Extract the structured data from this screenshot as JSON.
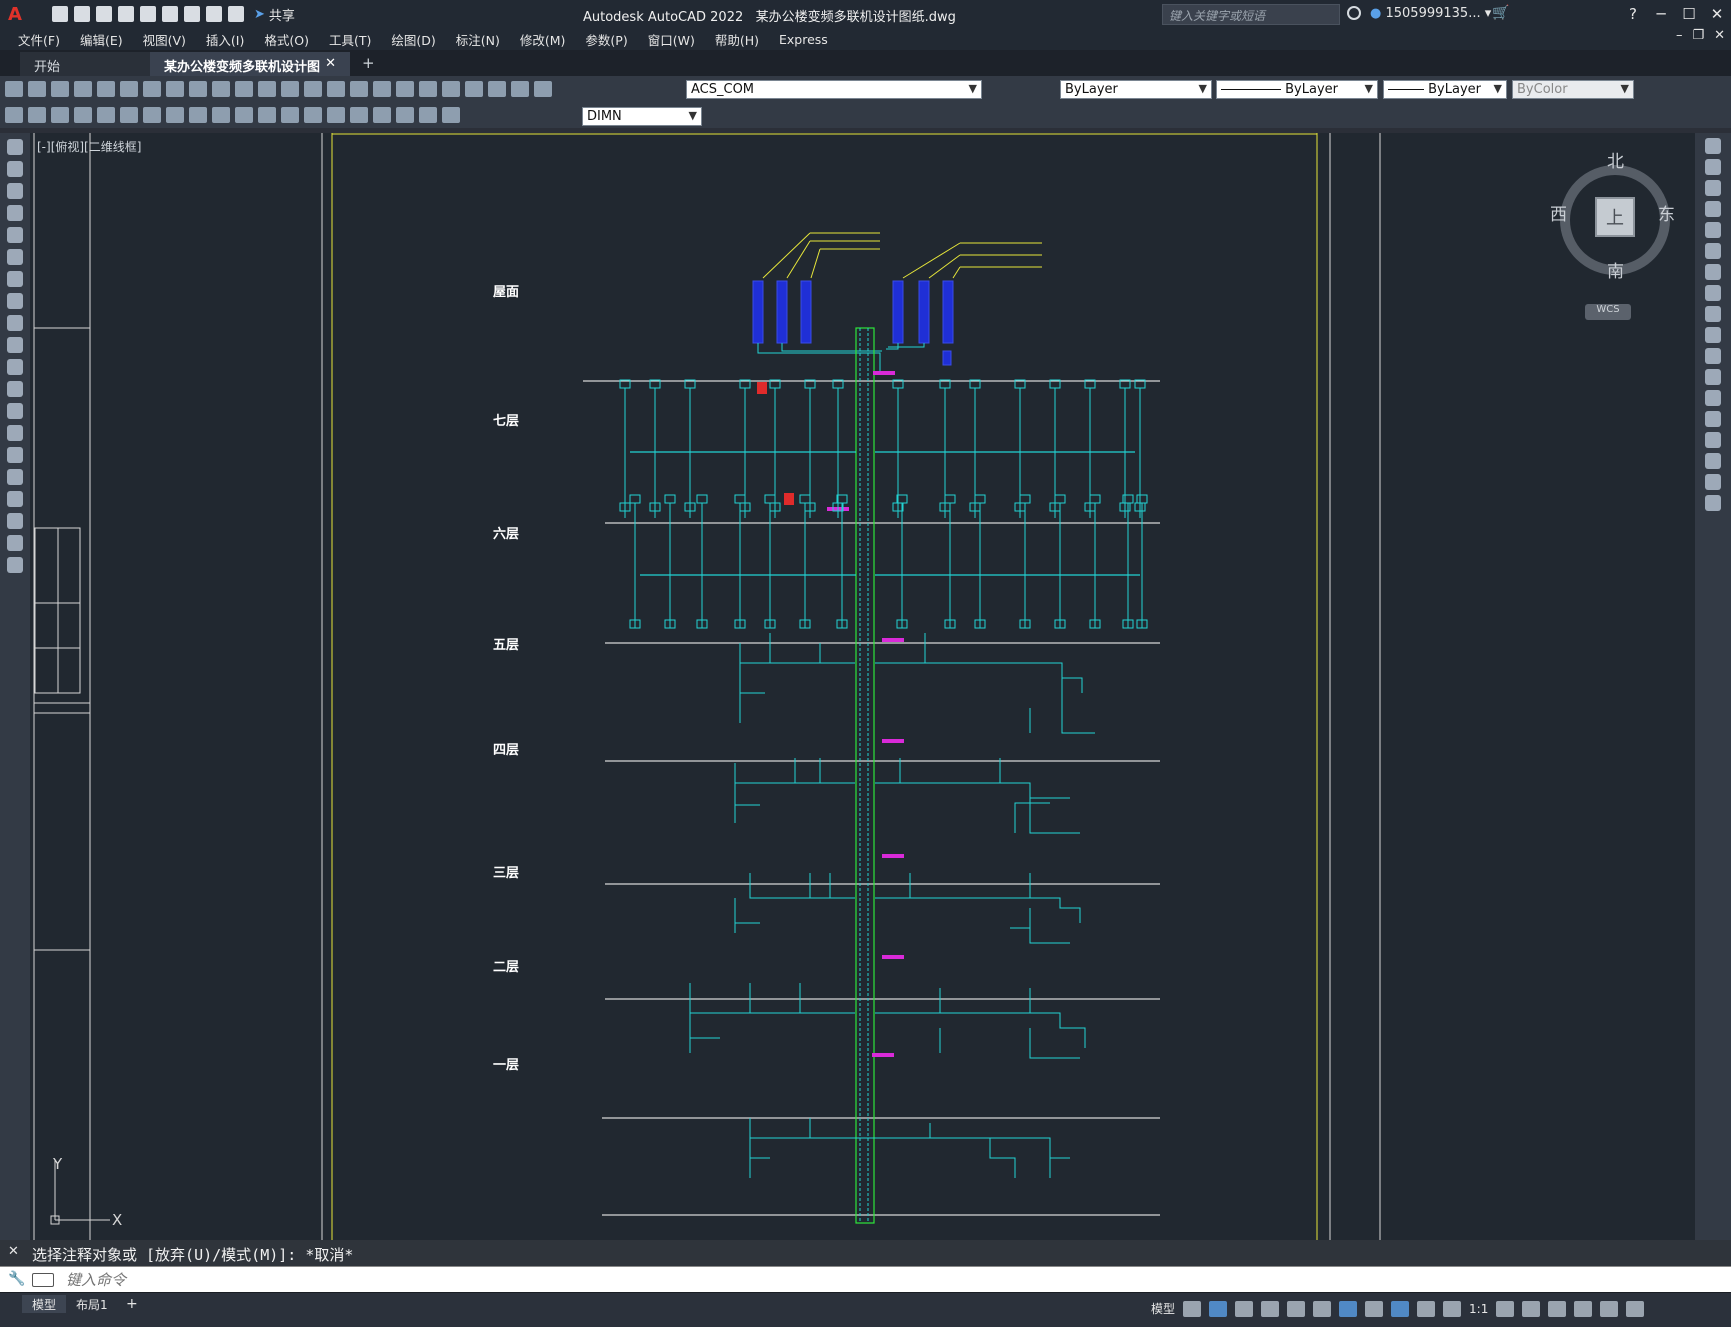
{
  "app": {
    "title": "Autodesk AutoCAD 2022",
    "document_name": "某办公楼变频多联机设计图纸.dwg",
    "search_placeholder": "键入关键字或短语",
    "user_name": "1505999135...",
    "share_label": "共享"
  },
  "menu": [
    "文件(F)",
    "编辑(E)",
    "视图(V)",
    "插入(I)",
    "格式(O)",
    "工具(T)",
    "绘图(D)",
    "标注(N)",
    "修改(M)",
    "参数(P)",
    "窗口(W)",
    "帮助(H)",
    "Express"
  ],
  "tabs": {
    "start": "开始",
    "active": "某办公楼变频多联机设计图纸*",
    "close_glyph": "✕",
    "add_glyph": "+"
  },
  "toolbar": {
    "layer_value": "ACS_COM",
    "color_value": "ByLayer",
    "linetype_value": "ByLayer",
    "lineweight_value": "ByLayer",
    "plotstyle_value": "ByColor",
    "dimstyle_value": "DIMN"
  },
  "viewport": {
    "label": "[-][俯视][二维线框]",
    "viewcube": {
      "north": "北",
      "south": "南",
      "east": "东",
      "west": "西",
      "face": "上"
    },
    "wcs_label": "WCS",
    "ucs": {
      "x": "X",
      "y": "Y"
    }
  },
  "drawing": {
    "floors": [
      "屋面",
      "七层",
      "六层",
      "五层",
      "四层",
      "三层",
      "二层",
      "一层"
    ],
    "colors": {
      "pipe": "#22d3d3",
      "riser": "#2ee63a",
      "unit": "#1f2fd6",
      "frame": "#e6e63a",
      "line": "#d6d6d6",
      "tag": "#d92ad9",
      "alert": "#e02b2b"
    }
  },
  "command": {
    "history": "选择注释对象或 [放弃(U)/模式(M)]: *取消*",
    "placeholder": "键入命令"
  },
  "status": {
    "model_tab": "模型",
    "layout_tab": "布局1",
    "mode_label": "模型",
    "scale": "1:1"
  }
}
